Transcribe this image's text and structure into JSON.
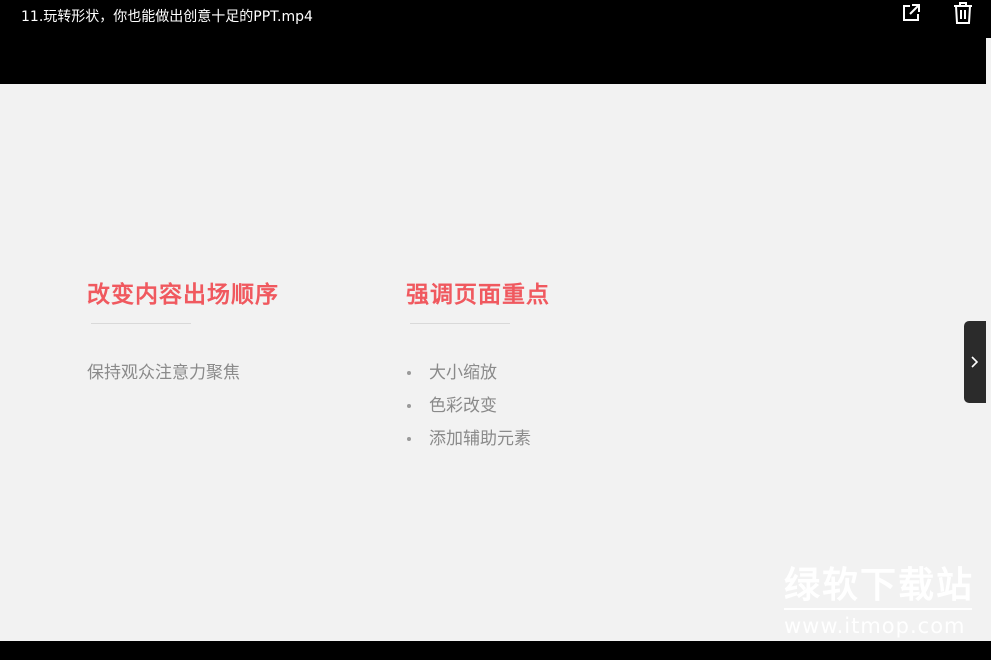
{
  "window": {
    "title": "11.玩转形状，你也能做出创意十足的PPT.mp4",
    "open_external_icon": "open-external-icon",
    "delete_icon": "trash-icon"
  },
  "slide": {
    "left": {
      "heading": "改变内容出场顺序",
      "body": "保持观众注意力聚焦"
    },
    "right": {
      "heading": "强调页面重点",
      "bullets": [
        "大小缩放",
        "色彩改变",
        "添加辅助元素"
      ]
    },
    "accent_color": "#f0595f",
    "text_color": "#8a8a8a",
    "background_color": "#f2f2f2"
  },
  "navigation": {
    "next_icon": "chevron-right-icon"
  },
  "watermark": {
    "brand": "绿软下载站",
    "url": "www.itmop.com"
  }
}
